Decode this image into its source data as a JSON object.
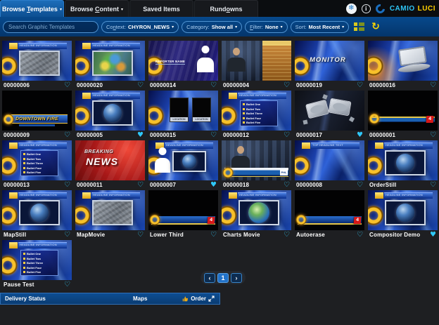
{
  "header": {
    "tabs": [
      {
        "pre": "Browse ",
        "key": "T",
        "post": "emplates",
        "has_caret": true,
        "active": true
      },
      {
        "pre": "Browse ",
        "key": "C",
        "post": "ontent",
        "has_caret": true,
        "active": false
      },
      {
        "pre": "Saved Items",
        "key": "",
        "post": "",
        "has_caret": false,
        "active": false
      },
      {
        "pre": "Rund",
        "key": "o",
        "post": "wns",
        "has_caret": false,
        "active": false
      }
    ],
    "brand": {
      "camio": "CAMIO",
      "luci": "LUCI"
    }
  },
  "icons": {
    "caret": "▾",
    "snowflake": "❄",
    "info": "i",
    "refresh": "↻",
    "prev": "‹",
    "next": "›"
  },
  "toolbar": {
    "search_placeholder": "Search Graphic Templates",
    "dropdowns": [
      {
        "pre": "Co",
        "key": "n",
        "post": "text:",
        "value": "CHYRON_NEWS"
      },
      {
        "pre": "Category:",
        "key": "",
        "post": "",
        "value": "Show all"
      },
      {
        "pre": "",
        "key": "F",
        "post": "ilter:",
        "value": "None"
      },
      {
        "pre": "Sort:",
        "key": "",
        "post": "",
        "value": "Most Recent"
      }
    ]
  },
  "grid": {
    "headline_bar_text": "HEADLINE INFORMATION",
    "top_headline_text": "TOP HEADLINE TEXT",
    "bullet_rows": [
      "Bullet One",
      "Bullet Two",
      "Bullet Three",
      "Bullet Four",
      "Bullet Five"
    ],
    "reporter_name": "REPORTER NAME",
    "location_label": "LOCATION",
    "chip_text": "PHL",
    "hearts": {
      "outline": "♡",
      "filled": "♥"
    },
    "cards": [
      {
        "label": "00000006",
        "variant": "map",
        "heart": "outline"
      },
      {
        "label": "00000020",
        "variant": "radar",
        "heart": "outline"
      },
      {
        "label": "00000014",
        "variant": "reporter",
        "heart": "outline"
      },
      {
        "label": "00000004",
        "variant": "anchor-chart",
        "heart": "outline"
      },
      {
        "label": "00000019",
        "variant": "monitor-text",
        "heart": "outline",
        "overlay": "MONITOR"
      },
      {
        "label": "00000016",
        "variant": "monitor3d",
        "heart": "outline"
      },
      {
        "label": "00000009",
        "variant": "black-lower-text",
        "heart": "outline",
        "overlay": "DOWNTOWN FIRE"
      },
      {
        "label": "00000005",
        "variant": "globe",
        "heart": "filled"
      },
      {
        "label": "00000015",
        "variant": "locations",
        "heart": "outline"
      },
      {
        "label": "00000012",
        "variant": "bullets",
        "heart": "outline"
      },
      {
        "label": "00000017",
        "variant": "blocks3d",
        "heart": "filled"
      },
      {
        "label": "00000001",
        "variant": "black-bar4",
        "heart": "outline",
        "badge": "4"
      },
      {
        "label": "00000013",
        "variant": "bullets",
        "heart": "outline"
      },
      {
        "label": "00000011",
        "variant": "breaking",
        "heart": "outline",
        "overlay_lines": [
          "BREAKING",
          "NEWS"
        ]
      },
      {
        "label": "00000007",
        "variant": "silhouette-globe",
        "heart": "filled"
      },
      {
        "label": "00000018",
        "variant": "anchor-lower",
        "heart": "outline"
      },
      {
        "label": "00000008",
        "variant": "plain-headline",
        "heart": "outline"
      },
      {
        "label": "OrderStill",
        "variant": "globe",
        "heart": "outline"
      },
      {
        "label": "MapStill",
        "variant": "globe",
        "heart": "outline"
      },
      {
        "label": "MapMovie",
        "variant": "map",
        "heart": "outline"
      },
      {
        "label": "Lower Third",
        "variant": "black-lower4",
        "heart": "outline",
        "badge": "4"
      },
      {
        "label": "Charts Movie",
        "variant": "green-globe",
        "heart": "outline"
      },
      {
        "label": "Autoerase",
        "variant": "black-lower4",
        "heart": "outline",
        "badge": "4"
      },
      {
        "label": "Compositor Demo",
        "variant": "globe",
        "heart": "filled"
      },
      {
        "label": "Pause Test",
        "variant": "bullets",
        "heart": "outline"
      }
    ]
  },
  "pagination": {
    "prev": "‹",
    "page": "1",
    "next": "›"
  },
  "footer": {
    "delivery_status": "Delivery Status",
    "maps": "Maps",
    "order": "Order"
  },
  "colors": {
    "accent_cyan": "#2fc8f8",
    "brand_cyan": "#2ec4f4",
    "brand_yellow": "#ffd100",
    "tab_active_blue": "#1160a8",
    "toolbar_blue": "#05417c",
    "footer_blue": "#0d4d92",
    "refresh_yellow": "#ffd800",
    "badge_red": "#d81818"
  }
}
